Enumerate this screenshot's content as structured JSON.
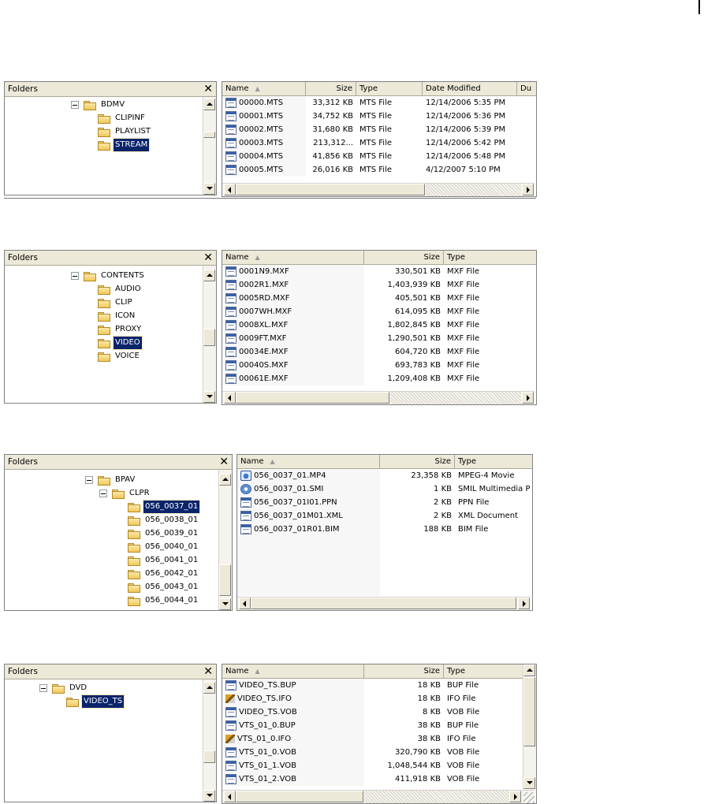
{
  "explorers": [
    {
      "folders_title": "Folders",
      "close_label": "✕",
      "tree": [
        {
          "label": "BDMV",
          "expanded": true,
          "selected": false
        },
        {
          "label": "CLIPINF",
          "expanded": false,
          "selected": false
        },
        {
          "label": "PLAYLIST",
          "expanded": false,
          "selected": false
        },
        {
          "label": "STREAM",
          "expanded": false,
          "selected": true
        }
      ],
      "columns": [
        "Name",
        "Size",
        "Type",
        "Date Modified",
        "Du"
      ],
      "files": [
        {
          "name": "00000.MTS",
          "size": "33,312 KB",
          "type": "MTS File",
          "date": "12/14/2006 5:35 PM",
          "icon": "file-icon"
        },
        {
          "name": "00001.MTS",
          "size": "34,752 KB",
          "type": "MTS File",
          "date": "12/14/2006 5:36 PM",
          "icon": "file-icon"
        },
        {
          "name": "00002.MTS",
          "size": "31,680 KB",
          "type": "MTS File",
          "date": "12/14/2006 5:39 PM",
          "icon": "file-icon"
        },
        {
          "name": "00003.MTS",
          "size": "213,312...",
          "type": "MTS File",
          "date": "12/14/2006 5:42 PM",
          "icon": "file-icon"
        },
        {
          "name": "00004.MTS",
          "size": "41,856 KB",
          "type": "MTS File",
          "date": "12/14/2006 5:48 PM",
          "icon": "file-icon"
        },
        {
          "name": "00005.MTS",
          "size": "26,016 KB",
          "type": "MTS File",
          "date": "4/12/2007 5:10 PM",
          "icon": "file-icon"
        }
      ]
    },
    {
      "folders_title": "Folders",
      "close_label": "✕",
      "tree": [
        {
          "label": "CONTENTS",
          "expanded": true,
          "selected": false
        },
        {
          "label": "AUDIO",
          "expanded": false,
          "selected": false
        },
        {
          "label": "CLIP",
          "expanded": false,
          "selected": false
        },
        {
          "label": "ICON",
          "expanded": false,
          "selected": false
        },
        {
          "label": "PROXY",
          "expanded": false,
          "selected": false
        },
        {
          "label": "VIDEO",
          "expanded": false,
          "selected": true
        },
        {
          "label": "VOICE",
          "expanded": false,
          "selected": false
        }
      ],
      "columns": [
        "Name",
        "Size",
        "Type"
      ],
      "files": [
        {
          "name": "0001N9.MXF",
          "size": "330,501 KB",
          "type": "MXF File",
          "icon": "file-icon"
        },
        {
          "name": "0002R1.MXF",
          "size": "1,403,939 KB",
          "type": "MXF File",
          "icon": "file-icon"
        },
        {
          "name": "0005RD.MXF",
          "size": "405,501 KB",
          "type": "MXF File",
          "icon": "file-icon"
        },
        {
          "name": "0007WH.MXF",
          "size": "614,095 KB",
          "type": "MXF File",
          "icon": "file-icon"
        },
        {
          "name": "0008XL.MXF",
          "size": "1,802,845 KB",
          "type": "MXF File",
          "icon": "file-icon"
        },
        {
          "name": "0009FT.MXF",
          "size": "1,290,501 KB",
          "type": "MXF File",
          "icon": "file-icon"
        },
        {
          "name": "00034E.MXF",
          "size": "604,720 KB",
          "type": "MXF File",
          "icon": "file-icon"
        },
        {
          "name": "00040S.MXF",
          "size": "693,783 KB",
          "type": "MXF File",
          "icon": "file-icon"
        },
        {
          "name": "00061E.MXF",
          "size": "1,209,408 KB",
          "type": "MXF File",
          "icon": "file-icon"
        }
      ]
    },
    {
      "folders_title": "Folders",
      "close_label": "✕",
      "tree": [
        {
          "label": "BPAV",
          "expanded": true,
          "selected": false
        },
        {
          "label": "CLPR",
          "expanded": true,
          "selected": false
        },
        {
          "label": "056_0037_01",
          "expanded": false,
          "selected": true
        },
        {
          "label": "056_0038_01",
          "expanded": false,
          "selected": false
        },
        {
          "label": "056_0039_01",
          "expanded": false,
          "selected": false
        },
        {
          "label": "056_0040_01",
          "expanded": false,
          "selected": false
        },
        {
          "label": "056_0041_01",
          "expanded": false,
          "selected": false
        },
        {
          "label": "056_0042_01",
          "expanded": false,
          "selected": false
        },
        {
          "label": "056_0043_01",
          "expanded": false,
          "selected": false
        },
        {
          "label": "056_0044_01",
          "expanded": false,
          "selected": false
        }
      ],
      "columns": [
        "Name",
        "Size",
        "Type"
      ],
      "files": [
        {
          "name": "056_0037_01.MP4",
          "size": "23,358 KB",
          "type": "MPEG-4 Movie",
          "icon": "media-file-icon"
        },
        {
          "name": "056_0037_01.SMI",
          "size": "1 KB",
          "type": "SMIL Multimedia P",
          "icon": "smil-file-icon"
        },
        {
          "name": "056_0037_01I01.PPN",
          "size": "2 KB",
          "type": "PPN File",
          "icon": "file-icon"
        },
        {
          "name": "056_0037_01M01.XML",
          "size": "2 KB",
          "type": "XML Document",
          "icon": "file-icon"
        },
        {
          "name": "056_0037_01R01.BIM",
          "size": "188 KB",
          "type": "BIM File",
          "icon": "file-icon"
        }
      ]
    },
    {
      "folders_title": "Folders",
      "close_label": "✕",
      "tree": [
        {
          "label": "DVD",
          "expanded": true,
          "selected": false
        },
        {
          "label": "VIDEO_TS",
          "expanded": false,
          "selected": true
        }
      ],
      "columns": [
        "Name",
        "Size",
        "Type"
      ],
      "files": [
        {
          "name": "VIDEO_TS.BUP",
          "size": "18 KB",
          "type": "BUP File",
          "icon": "file-icon"
        },
        {
          "name": "VIDEO_TS.IFO",
          "size": "18 KB",
          "type": "IFO File",
          "icon": "ifo-file-icon"
        },
        {
          "name": "VIDEO_TS.VOB",
          "size": "8 KB",
          "type": "VOB File",
          "icon": "file-icon"
        },
        {
          "name": "VTS_01_0.BUP",
          "size": "38 KB",
          "type": "BUP File",
          "icon": "file-icon"
        },
        {
          "name": "VTS_01_0.IFO",
          "size": "38 KB",
          "type": "IFO File",
          "icon": "ifo-file-icon"
        },
        {
          "name": "VTS_01_0.VOB",
          "size": "320,790 KB",
          "type": "VOB File",
          "icon": "file-icon"
        },
        {
          "name": "VTS_01_1.VOB",
          "size": "1,048,544 KB",
          "type": "VOB File",
          "icon": "file-icon"
        },
        {
          "name": "VTS_01_2.VOB",
          "size": "411,918 KB",
          "type": "VOB File",
          "icon": "file-icon"
        }
      ]
    }
  ]
}
